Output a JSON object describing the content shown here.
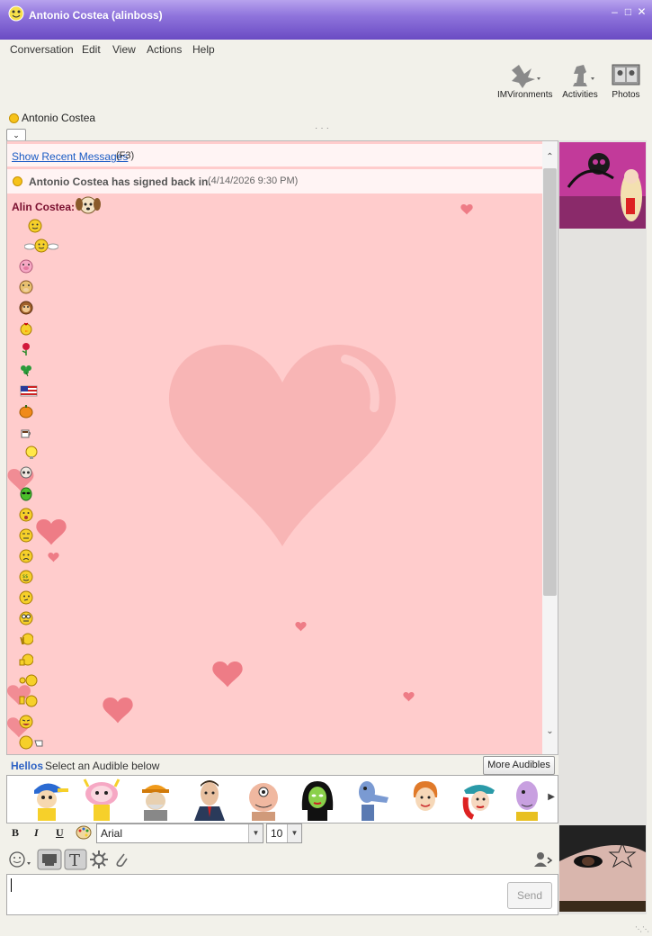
{
  "window": {
    "title": "Antonio Costea (alinboss)"
  },
  "menu": [
    "Conversation",
    "Edit",
    "View",
    "Actions",
    "Help"
  ],
  "toolbar": {
    "imvironments": "IMVironments",
    "activities": "Activities",
    "photos": "Photos"
  },
  "contact": {
    "name": "Antonio Costea"
  },
  "conversation": {
    "show_recent": "Show Recent Messages",
    "show_recent_key": "(F3)",
    "signin_message": "Antonio Costea has signed back in.",
    "signin_time": "(4/14/2026 9:30 PM)",
    "sender": "Alin Costea:"
  },
  "hellos": {
    "label": "Hellos",
    "sub": "Select an Audible below",
    "more": "More Audibles"
  },
  "format": {
    "font": "Arial",
    "size": "10"
  },
  "compose": {
    "send": "Send"
  },
  "colors": {
    "titlebar": "#7a5ccf",
    "imvironment_bg": "#ffcccc",
    "link": "#1a5bc4"
  }
}
